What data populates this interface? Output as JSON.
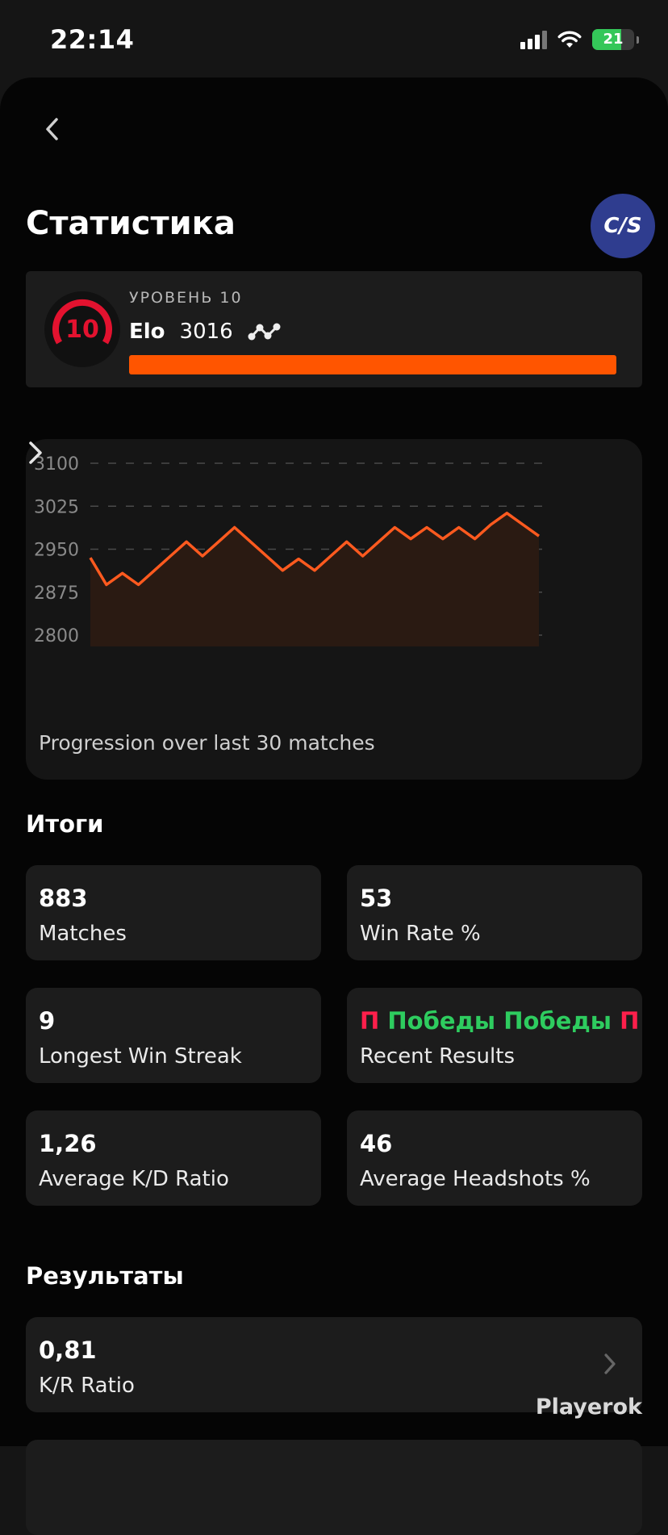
{
  "status_bar": {
    "time": "22:14",
    "battery": "21"
  },
  "header": {
    "title": "Статистика",
    "game_logo": "C/S"
  },
  "level": {
    "badge": "10",
    "label": "УРОВЕНЬ 10",
    "elo_label": "Elo",
    "elo_value": "3016",
    "progress": 1.0
  },
  "chart": {
    "caption": "Progression over last 30 matches",
    "line_color": "#ff5a1f"
  },
  "chart_data": {
    "type": "area",
    "yticks": [
      "3100",
      "3025",
      "2950",
      "2875",
      "2800"
    ],
    "ylim": [
      2800,
      3100
    ],
    "values": [
      2935,
      2888,
      2908,
      2888,
      2913,
      2938,
      2963,
      2938,
      2963,
      2988,
      2963,
      2938,
      2913,
      2933,
      2913,
      2938,
      2963,
      2938,
      2963,
      2988,
      2968,
      2988,
      2968,
      2988,
      2968,
      2993,
      3013,
      2993,
      2973
    ],
    "grid": true
  },
  "summary": {
    "title": "Итоги",
    "cards": [
      {
        "value": "883",
        "label": "Matches"
      },
      {
        "value": "53",
        "label": "Win Rate %"
      },
      {
        "value": "9",
        "label": "Longest Win Streak"
      },
      {
        "label": "Recent Results"
      },
      {
        "value": "1,26",
        "label": "Average K/D Ratio"
      },
      {
        "value": "46",
        "label": "Average Headshots %"
      }
    ],
    "recent_results": [
      "П",
      "Победы",
      "Победы",
      "П",
      "П"
    ]
  },
  "results": {
    "title": "Результаты",
    "rows": [
      {
        "value": "0,81",
        "label": "K/R Ratio"
      }
    ]
  },
  "watermark": "Playerok",
  "colors": {
    "accent": "#ff5500",
    "win": "#2ecc5f",
    "loss": "#ff1f4b",
    "badge_ring": "#e3122f",
    "logo_bg": "#2f3d8f"
  }
}
